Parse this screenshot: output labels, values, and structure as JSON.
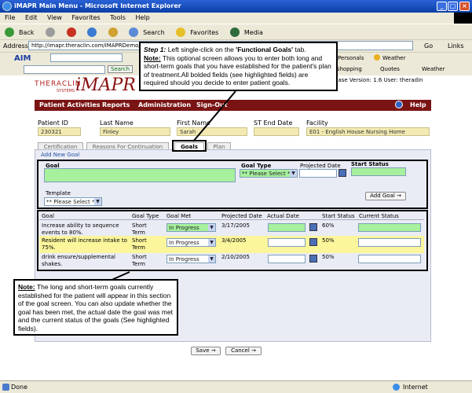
{
  "window": {
    "title": "iMAPR Main Menu - Microsoft Internet Explorer"
  },
  "menu": [
    "File",
    "Edit",
    "View",
    "Favorites",
    "Tools",
    "Help"
  ],
  "toolbar": {
    "back": "Back",
    "search": "Search",
    "favorites": "Favorites",
    "media": "Media"
  },
  "address": {
    "label": "Address",
    "url": "http://imapr.theraclin.com/iMAPRDemo/",
    "go": "Go",
    "links": "Links"
  },
  "links": {
    "aim": "AIM",
    "search": "Search",
    "personals": "Personals",
    "weather": "Weather",
    "shopping": "Shopping",
    "quotes": "Quotes",
    "weather2": "Weather"
  },
  "app": {
    "brand_small": "THERACLIN",
    "brand_sub": "SYSTEMS",
    "brand_big": "iMAPR",
    "db_version": "base Version: 1.6 User: theradin"
  },
  "nav": {
    "patient": "Patient Activities",
    "reports": "Reports",
    "admin": "Administration",
    "signout": "Sign-Out",
    "help": "Help"
  },
  "patient": {
    "id_label": "Patient ID",
    "id": "230321",
    "last_label": "Last Name",
    "last": "Finley",
    "first_label": "First Name",
    "first": "Sarah",
    "st_label": "ST End Date",
    "st": "",
    "facility_label": "Facility",
    "facility": "E01 - English House Nursing Home"
  },
  "tabs": {
    "cert": "Certification",
    "reasons": "Reasons For Continuation",
    "goals": "Goals",
    "plan": "Plan"
  },
  "form": {
    "add_new": "Add New Goal",
    "goal": "Goal",
    "goal_type": "Goal Type",
    "projected": "Projected Date",
    "start_status": "Start Status",
    "please_select": "** Please Select **",
    "template": "Template",
    "add_goal": "Add Goal"
  },
  "table": {
    "headers": [
      "Goal",
      "Goal Type",
      "Goal Met",
      "Projected Date",
      "Actual Date",
      "Start Status",
      "Current Status"
    ],
    "rows": [
      {
        "goal": "Increase ability to sequence events to 80%.",
        "type": "Short Term",
        "met": "In Progress",
        "proj": "3/17/2005",
        "start": "60%"
      },
      {
        "goal": "Resident will increase intake to 75%.",
        "type": "Short Term",
        "met": "In Progress",
        "proj": "3/4/2005",
        "start": "50%"
      },
      {
        "goal": "drink ensure/supplemental shakes.",
        "type": "Short Term",
        "met": "In Progress",
        "proj": "2/10/2005",
        "start": "50%"
      }
    ]
  },
  "buttons": {
    "save": "Save",
    "cancel": "Cancel"
  },
  "callout1": {
    "step": "Step 1:",
    "text": " Left single-click on the ",
    "tab": "'Functional Goals'",
    "tail": " tab.",
    "note": "Note:",
    "note_text": " This optional screen allows you to enter both long and short-term goals that you have established for the patient's plan of treatment.All bolded fields (see highlighted fields) are required should you decide to enter patient goals."
  },
  "callout2": {
    "note": "Note:",
    "text": " The long and short-term goals currently established for the patient will appear in this section of the goal screen. You can also update whether the goal has been met, the actual date the goal was met and the current status of the goals (See highlighted fields)."
  },
  "status": {
    "left": "Done",
    "zone": "Internet"
  }
}
